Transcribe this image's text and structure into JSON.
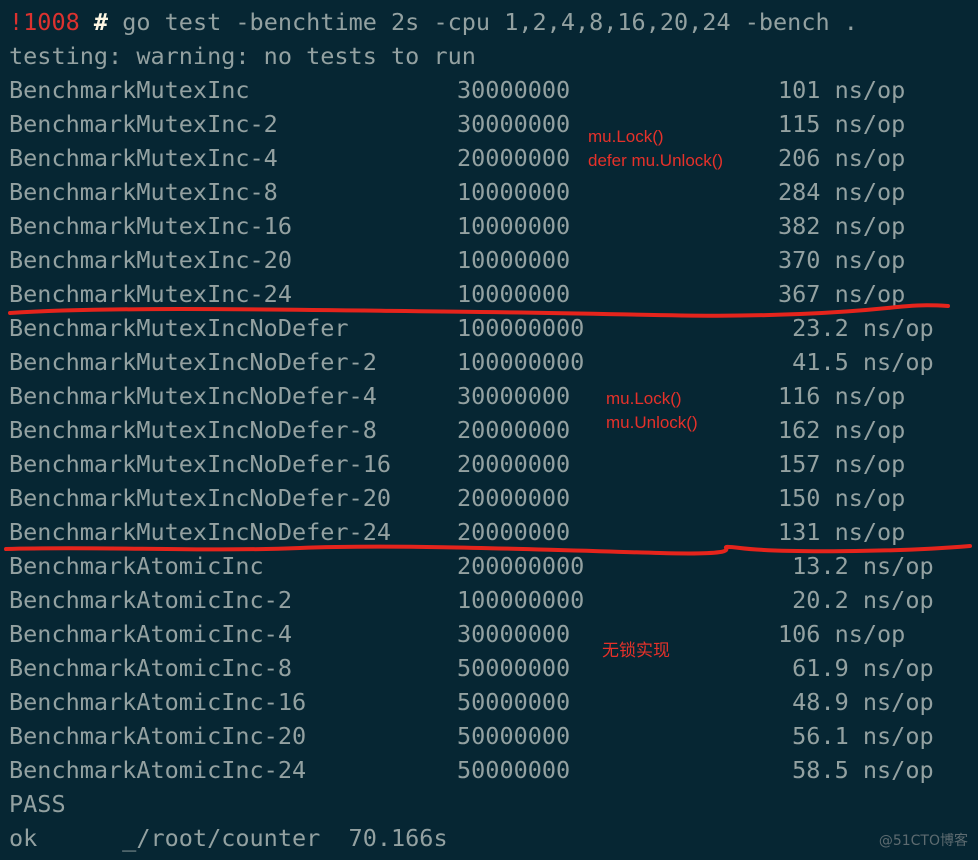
{
  "terminal": {
    "prompt_number": "!1008",
    "prompt_symbol": "#",
    "command": "go test -benchtime 2s -cpu 1,2,4,8,16,20,24 -bench .",
    "warning": "testing: warning: no tests to run",
    "results": [
      {
        "name": "BenchmarkMutexInc",
        "iterations": "30000000",
        "ns_op": "101 ns/op"
      },
      {
        "name": "BenchmarkMutexInc-2",
        "iterations": "30000000",
        "ns_op": "115 ns/op"
      },
      {
        "name": "BenchmarkMutexInc-4",
        "iterations": "20000000",
        "ns_op": "206 ns/op"
      },
      {
        "name": "BenchmarkMutexInc-8",
        "iterations": "10000000",
        "ns_op": "284 ns/op"
      },
      {
        "name": "BenchmarkMutexInc-16",
        "iterations": "10000000",
        "ns_op": "382 ns/op"
      },
      {
        "name": "BenchmarkMutexInc-20",
        "iterations": "10000000",
        "ns_op": "370 ns/op"
      },
      {
        "name": "BenchmarkMutexInc-24",
        "iterations": "10000000",
        "ns_op": "367 ns/op"
      },
      {
        "name": "BenchmarkMutexIncNoDefer",
        "iterations": "100000000",
        "ns_op": " 23.2 ns/op"
      },
      {
        "name": "BenchmarkMutexIncNoDefer-2",
        "iterations": "100000000",
        "ns_op": " 41.5 ns/op"
      },
      {
        "name": "BenchmarkMutexIncNoDefer-4",
        "iterations": "30000000",
        "ns_op": "116 ns/op"
      },
      {
        "name": "BenchmarkMutexIncNoDefer-8",
        "iterations": "20000000",
        "ns_op": "162 ns/op"
      },
      {
        "name": "BenchmarkMutexIncNoDefer-16",
        "iterations": "20000000",
        "ns_op": "157 ns/op"
      },
      {
        "name": "BenchmarkMutexIncNoDefer-20",
        "iterations": "20000000",
        "ns_op": "150 ns/op"
      },
      {
        "name": "BenchmarkMutexIncNoDefer-24",
        "iterations": "20000000",
        "ns_op": "131 ns/op"
      },
      {
        "name": "BenchmarkAtomicInc",
        "iterations": "200000000",
        "ns_op": " 13.2 ns/op"
      },
      {
        "name": "BenchmarkAtomicInc-2",
        "iterations": "100000000",
        "ns_op": " 20.2 ns/op"
      },
      {
        "name": "BenchmarkAtomicInc-4",
        "iterations": "30000000",
        "ns_op": "106 ns/op"
      },
      {
        "name": "BenchmarkAtomicInc-8",
        "iterations": "50000000",
        "ns_op": " 61.9 ns/op"
      },
      {
        "name": "BenchmarkAtomicInc-16",
        "iterations": "50000000",
        "ns_op": " 48.9 ns/op"
      },
      {
        "name": "BenchmarkAtomicInc-20",
        "iterations": "50000000",
        "ns_op": " 56.1 ns/op"
      },
      {
        "name": "BenchmarkAtomicInc-24",
        "iterations": "50000000",
        "ns_op": " 58.5 ns/op"
      }
    ],
    "pass": "PASS",
    "ok_line": "ok      _/root/counter  70.166s"
  },
  "annotations": {
    "defer_note_1": "mu.Lock()",
    "defer_note_2": "defer mu.Unlock()",
    "nodefer_note_1": "mu.Lock()",
    "nodefer_note_2": "mu.Unlock()",
    "atomic_note": "无锁实现",
    "color": "#e5312a"
  },
  "watermark": "@51CTO博客"
}
